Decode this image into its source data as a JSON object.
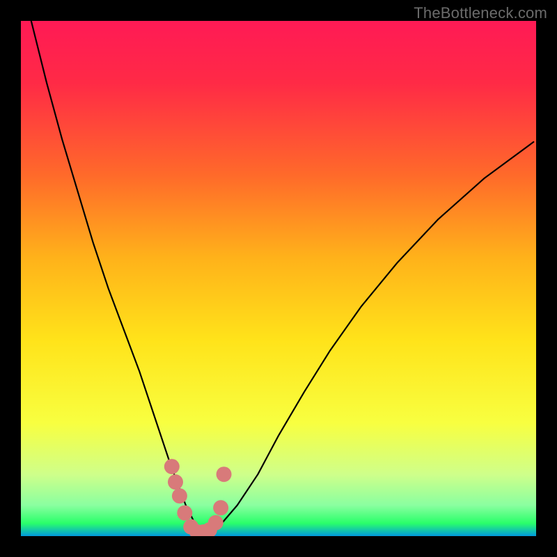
{
  "watermark": "TheBottleneck.com",
  "chart_data": {
    "type": "line",
    "title": "",
    "xlabel": "",
    "ylabel": "",
    "xlim": [
      0,
      100
    ],
    "ylim": [
      0,
      100
    ],
    "background_gradient": {
      "stops": [
        {
          "offset": 0.0,
          "color": "#ff1a55"
        },
        {
          "offset": 0.12,
          "color": "#ff2a46"
        },
        {
          "offset": 0.3,
          "color": "#ff6a2a"
        },
        {
          "offset": 0.46,
          "color": "#ffb21a"
        },
        {
          "offset": 0.62,
          "color": "#ffe31a"
        },
        {
          "offset": 0.78,
          "color": "#f8ff40"
        },
        {
          "offset": 0.88,
          "color": "#cfff8a"
        },
        {
          "offset": 0.94,
          "color": "#8affa0"
        },
        {
          "offset": 0.975,
          "color": "#2aff6a"
        },
        {
          "offset": 1.0,
          "color": "#0099dd"
        }
      ]
    },
    "series": [
      {
        "name": "bottleneck-curve",
        "color": "#000000",
        "stroke_width": 2.2,
        "x": [
          2,
          5,
          8,
          11,
          14,
          17,
          20,
          23,
          25,
          27,
          29,
          30.5,
          32,
          33.5,
          35,
          37,
          39,
          42,
          46,
          50,
          55,
          60,
          66,
          73,
          81,
          90,
          99.5
        ],
        "y": [
          100,
          88,
          77,
          67,
          57,
          48,
          40,
          32,
          26,
          20,
          14,
          10,
          6,
          3,
          1,
          1.2,
          2.5,
          6,
          12,
          19.5,
          28,
          36,
          44.5,
          53,
          61.5,
          69.5,
          76.5
        ]
      },
      {
        "name": "valley-markers",
        "type": "scatter",
        "color": "#d87a7a",
        "marker_size": 11,
        "x": [
          29.3,
          30.0,
          30.8,
          31.8,
          33.0,
          34.2,
          35.4,
          36.6,
          37.8,
          38.8,
          39.4
        ],
        "y": [
          13.5,
          10.5,
          7.8,
          4.5,
          1.8,
          0.8,
          0.8,
          1.2,
          2.6,
          5.5,
          12.0
        ]
      }
    ]
  }
}
